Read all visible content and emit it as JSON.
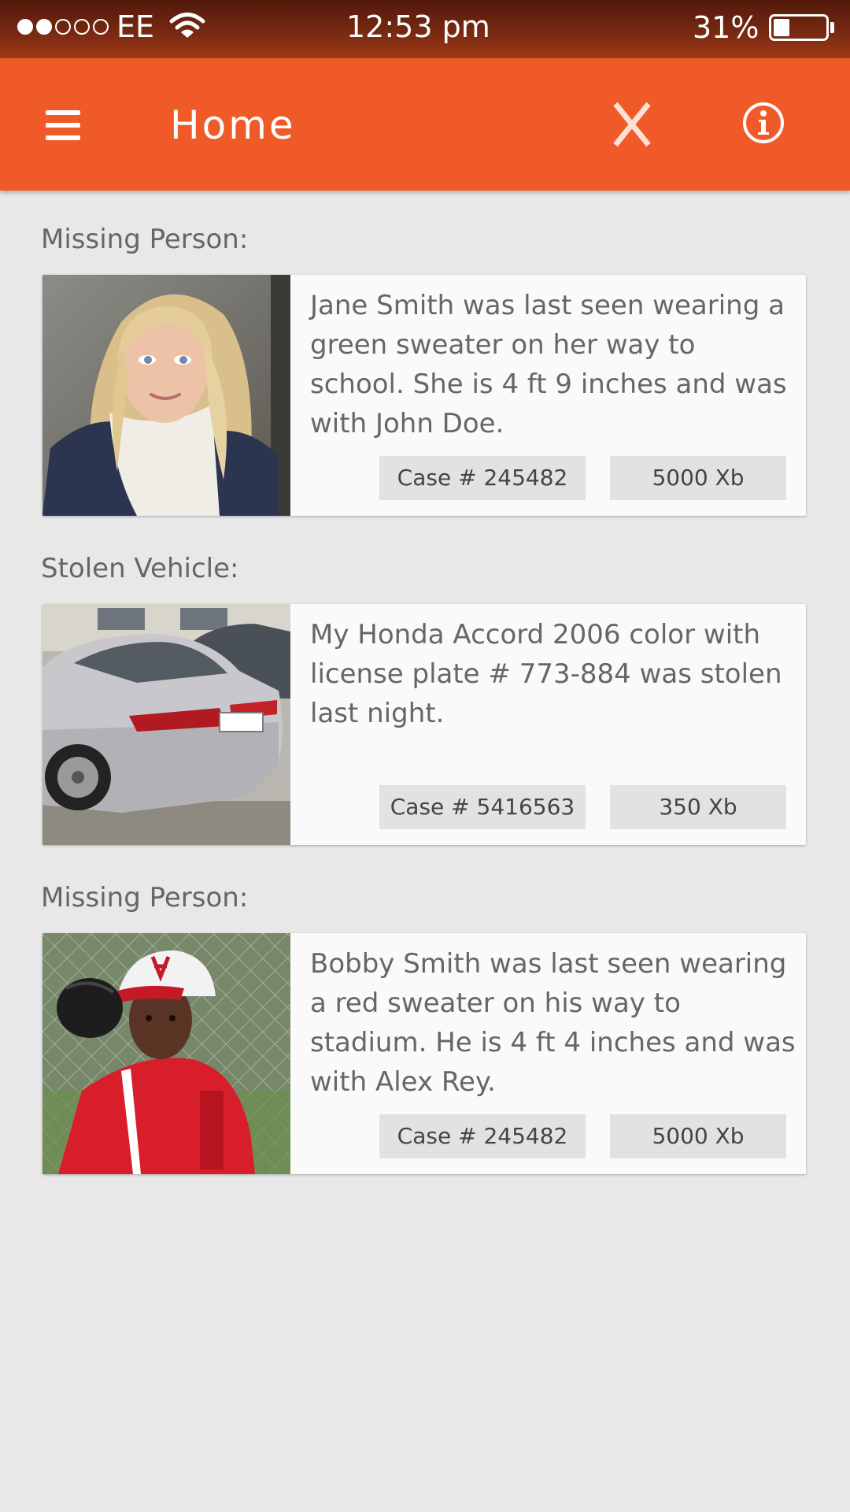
{
  "status_bar": {
    "carrier": "EE",
    "time": "12:53 pm",
    "battery_percent": "31%",
    "battery_level": 0.31,
    "signal_bars_filled": 2,
    "signal_bars_total": 5
  },
  "app_bar": {
    "title": "Home",
    "menu_icon": "hamburger-menu-icon",
    "close_icon": "close-icon",
    "info_icon": "info-icon",
    "accent_color": "#f05a28"
  },
  "cards": [
    {
      "category": "Missing Person:",
      "photo": "girl-portrait-photo",
      "description": "Jane Smith was last seen wearing a green sweater on her way to school. She is 4 ft 9 inches and was with John Doe.",
      "case": "Case # 245482",
      "reward": "5000 Xb"
    },
    {
      "category": "Stolen Vehicle:",
      "photo": "silver-car-photo",
      "description": "My Honda Accord 2006 color with license plate # 773-884 was stolen last night.",
      "case": "Case # 5416563",
      "reward": "350 Xb"
    },
    {
      "category": "Missing Person:",
      "photo": "boy-baseball-photo",
      "description": "Bobby Smith was last seen wearing a red sweater on his way to stadium. He is 4 ft 4 inches and was with Alex Rey.",
      "case": "Case # 245482",
      "reward": "5000 Xb"
    }
  ]
}
